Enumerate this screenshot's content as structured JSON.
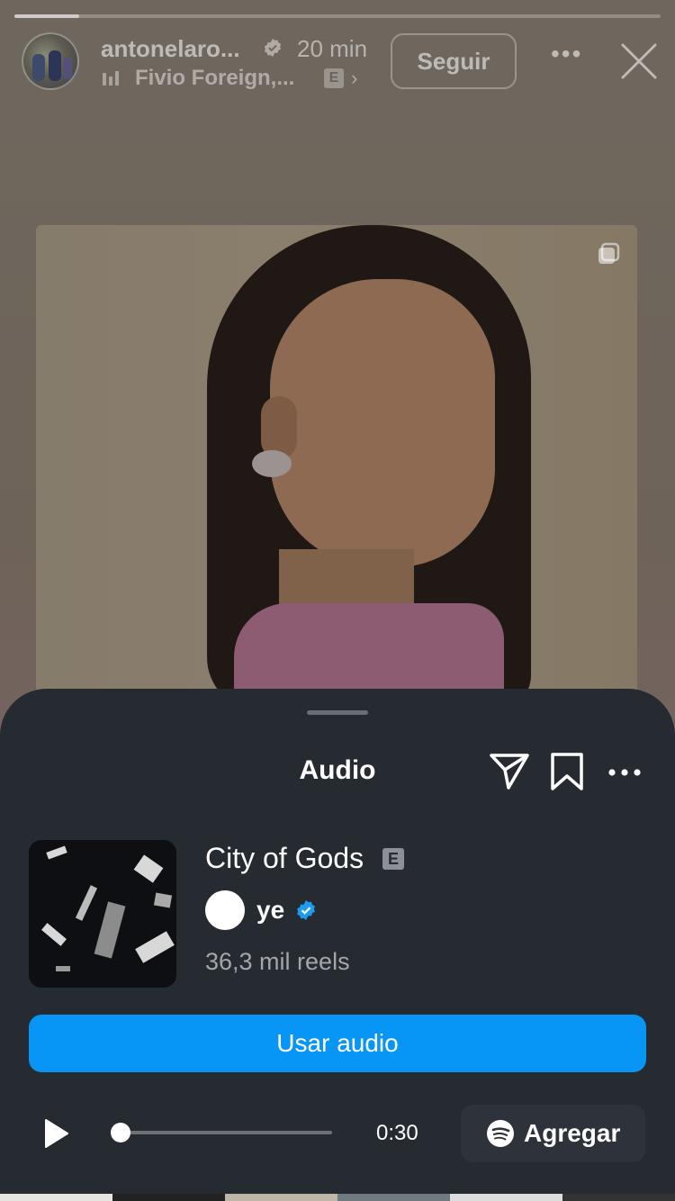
{
  "story": {
    "progress": 0.1,
    "username": "antonelaro...",
    "time_ago": "20 min",
    "music_label": "Fivio Foreign,...",
    "explicit_badge": "E",
    "follow_label": "Seguir"
  },
  "sheet": {
    "title": "Audio",
    "track_title": "City of Gods",
    "explicit_badge": "E",
    "artist": "ye",
    "reels_count": "36,3 mil reels",
    "use_audio_label": "Usar audio",
    "playback_progress": 0.0,
    "duration": "0:30",
    "spotify_label": "Agregar"
  },
  "colors": {
    "sheet_bg": "#262a31",
    "primary_button": "#0795f6",
    "verified_blue": "#1d9bf0"
  },
  "icons": [
    "verified-icon",
    "music-bars-icon",
    "chevron-right-icon",
    "more-icon",
    "close-icon",
    "carousel-icon",
    "share-icon",
    "bookmark-icon",
    "play-icon",
    "spotify-icon"
  ]
}
